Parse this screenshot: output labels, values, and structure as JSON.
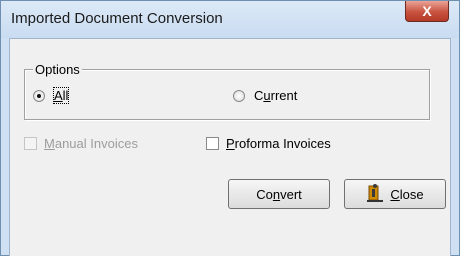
{
  "window": {
    "title": "Imported Document Conversion",
    "close_glyph": "X"
  },
  "options": {
    "legend": "Options",
    "radios": [
      {
        "label": "All",
        "selected": true,
        "accel": "A"
      },
      {
        "label": "Current",
        "selected": false,
        "accel": "u"
      }
    ]
  },
  "checkboxes": [
    {
      "label_pre": "",
      "accel": "M",
      "label_post": "anual Invoices",
      "enabled": false,
      "checked": false
    },
    {
      "label_pre": "",
      "accel": "P",
      "label_post": "roforma Invoices",
      "enabled": true,
      "checked": false
    }
  ],
  "buttons": {
    "convert": {
      "pre": "Co",
      "accel": "n",
      "post": "vert"
    },
    "close": {
      "pre": "",
      "accel": "C",
      "post": "lose",
      "icon": "exit-door-icon"
    }
  },
  "colors": {
    "titlebar": "#cfe0f3",
    "close_button": "#c8533f",
    "client": "#f0f0f0"
  }
}
